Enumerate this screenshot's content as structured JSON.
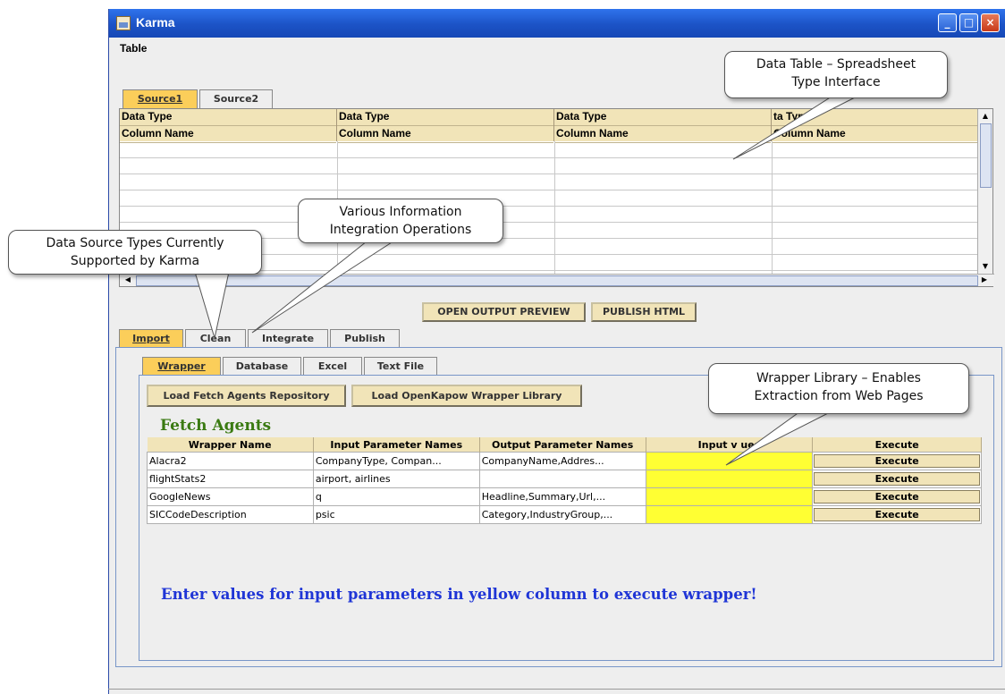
{
  "window": {
    "title": "Karma",
    "controls": {
      "minimize": "_",
      "maximize": "□",
      "close": "×"
    }
  },
  "menubar": {
    "items": [
      "Table"
    ]
  },
  "source_tabs": [
    "Source1",
    "Source2"
  ],
  "data_table": {
    "row1_label": "Data Type",
    "row2_label": "Column Name",
    "columns": [
      {
        "type": "Data Type",
        "name": "Column Name"
      },
      {
        "type": "Data Type",
        "name": "Column Name"
      },
      {
        "type": "Data Type",
        "name": "Column Name"
      },
      {
        "type": "ta Type",
        "name": "Column Name"
      }
    ]
  },
  "buttons": {
    "open_preview": "OPEN OUTPUT PREVIEW",
    "publish_html": "PUBLISH HTML"
  },
  "main_tabs": [
    "Import",
    "Clean",
    "Integrate",
    "Publish"
  ],
  "import_tabs": [
    "Wrapper",
    "Database",
    "Excel",
    "Text File"
  ],
  "wrapper": {
    "load_repo": "Load Fetch Agents Repository",
    "load_kapow": "Load OpenKapow Wrapper Library",
    "section_title": "Fetch Agents",
    "table": {
      "headers": [
        "Wrapper Name",
        "Input Parameter Names",
        "Output Parameter Names",
        "Input v   ues",
        "Execute"
      ],
      "rows": [
        {
          "name": "Alacra2",
          "inputs": "CompanyType, Compan...",
          "outputs": "CompanyName,Addres...",
          "value": "",
          "execute": "Execute"
        },
        {
          "name": "flightStats2",
          "inputs": "airport, airlines",
          "outputs": "",
          "value": "",
          "execute": "Execute"
        },
        {
          "name": "GoogleNews",
          "inputs": "q",
          "outputs": "Headline,Summary,Url,...",
          "value": "",
          "execute": "Execute"
        },
        {
          "name": "SICCodeDescription",
          "inputs": "psic",
          "outputs": "Category,IndustryGroup,...",
          "value": "",
          "execute": "Execute"
        }
      ]
    },
    "hint": "Enter values for input parameters in yellow column to execute wrapper!"
  },
  "callouts": {
    "data_table": [
      "Data Table – Spreadsheet",
      "Type Interface"
    ],
    "operations": [
      "Various Information",
      "Integration Operations"
    ],
    "source_types": [
      "Data Source Types Currently",
      "Supported by Karma"
    ],
    "wrapper_lib": [
      "Wrapper Library – Enables",
      "Extraction from Web Pages"
    ]
  },
  "colors": {
    "selected_tab": "#fbce5a",
    "header_bg": "#f1e4b8",
    "input_column": "#ffff33",
    "title_green": "#3a7a12",
    "hint_blue": "#1f35d6",
    "titlebar": "#1c53c6"
  }
}
